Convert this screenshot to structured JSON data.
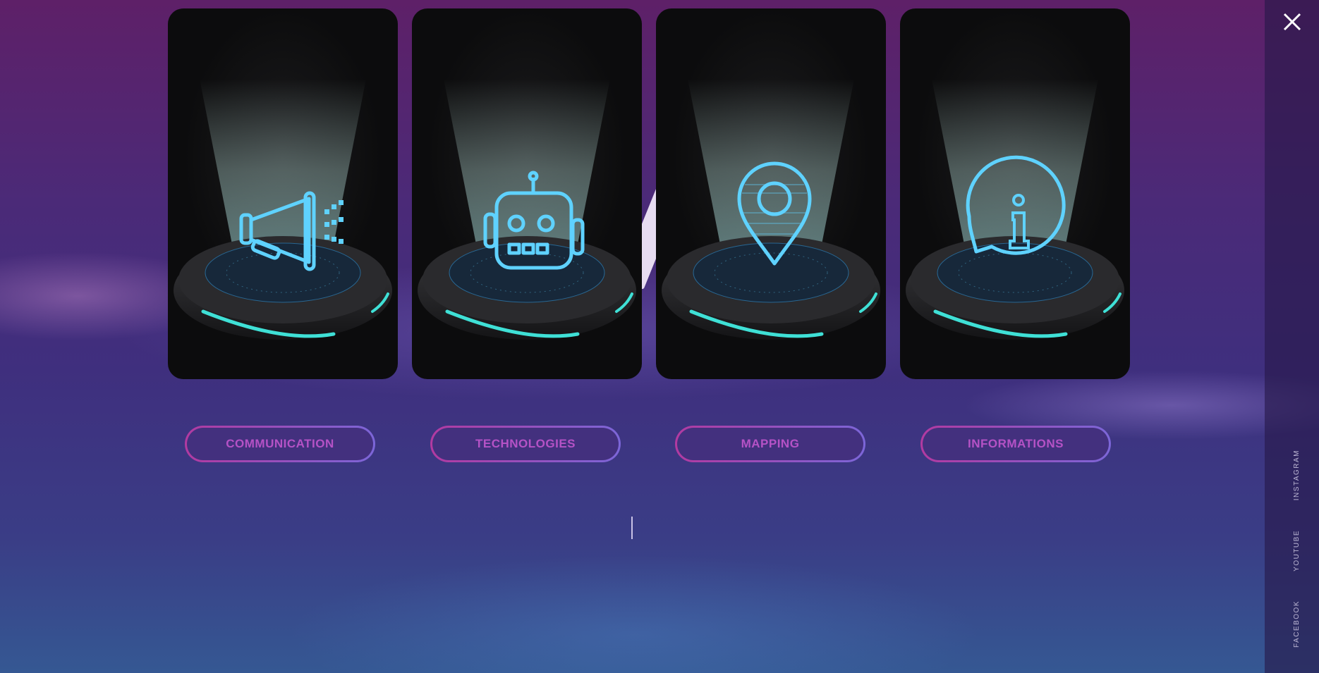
{
  "cards": [
    {
      "label": "COMMUNICATION",
      "icon": "megaphone-icon"
    },
    {
      "label": "TECHNOLOGIES",
      "icon": "robot-icon"
    },
    {
      "label": "MAPPING",
      "icon": "map-pin-icon"
    },
    {
      "label": "INFORMATIONS",
      "icon": "info-bubble-icon"
    }
  ],
  "sidebar": {
    "close_icon": "close-icon",
    "social": {
      "instagram": "INSTAGRAM",
      "youtube": "YOUTUBE",
      "facebook": "FACEBOOK"
    }
  },
  "colors": {
    "accent_pink": "#b552c6",
    "hologram_cyan": "#5fd2ff",
    "base_glow": "#3fe0d6"
  }
}
